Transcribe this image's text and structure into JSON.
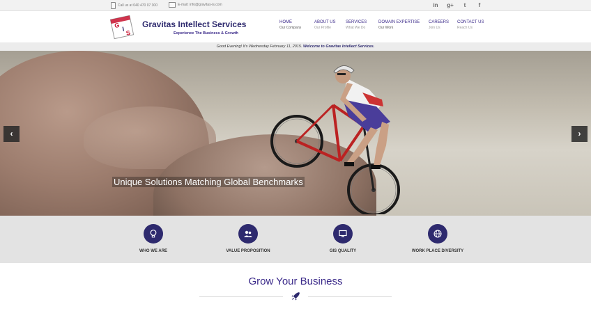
{
  "topbar": {
    "phone_label": "Call us at 040 470 07 300",
    "email_label": "E-mail: info@gravitas-is.com",
    "social": [
      {
        "icon": "linkedin-icon",
        "glyph": "in"
      },
      {
        "icon": "googleplus-icon",
        "glyph": "g+"
      },
      {
        "icon": "twitter-icon",
        "glyph": "t"
      },
      {
        "icon": "facebook-icon",
        "glyph": "f"
      }
    ]
  },
  "brand": {
    "name": "Gravitas Intellect Services",
    "tagline": "Experience The Business & Growth",
    "logo_text": "GIS"
  },
  "nav": [
    {
      "label": "HOME",
      "sub": "Our Company"
    },
    {
      "label": "ABOUT US",
      "sub": "Our Profile"
    },
    {
      "label": "SERVICES",
      "sub": "What We Do"
    },
    {
      "label": "DOMAIN EXPERTISE",
      "sub": "Our Work"
    },
    {
      "label": "CAREERS",
      "sub": "Join Us"
    },
    {
      "label": "CONTACT US",
      "sub": "Reach Us"
    }
  ],
  "greeting": {
    "text": "Good Evening! It's Wednesday February 11, 2015.",
    "welcome": "Welcome to Gravitas Intellect Services."
  },
  "hero": {
    "caption": "Unique Solutions Matching Global Benchmarks",
    "prev_glyph": "‹",
    "next_glyph": "›"
  },
  "features": [
    {
      "label": "WHO WE ARE",
      "icon": "lightbulb-icon"
    },
    {
      "label": "VALUE PROPOSITION",
      "icon": "users-icon"
    },
    {
      "label": "GIS QUALITY",
      "icon": "monitor-icon"
    },
    {
      "label": "WORK PLACE DIVERSITY",
      "icon": "globe-icon"
    }
  ],
  "grow": {
    "title": "Grow Your Business",
    "icon": "rocket-icon"
  },
  "colors": {
    "brand": "#2e2a6e",
    "accent": "#3b2a8a"
  }
}
